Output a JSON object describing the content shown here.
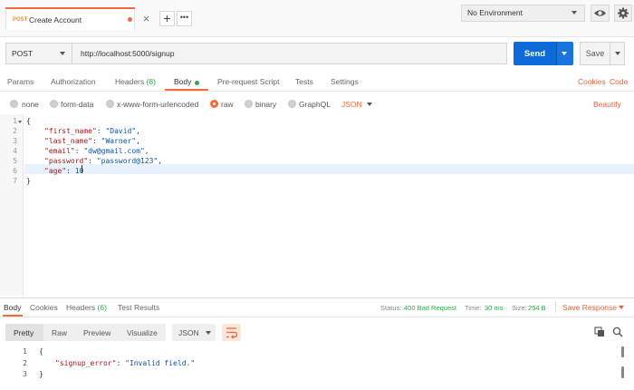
{
  "tab": {
    "method": "POST",
    "title": "Create Account",
    "close_icon": "close-icon",
    "add_label": "+",
    "more_label": "•••"
  },
  "environment": {
    "selected": "No Environment"
  },
  "request": {
    "method": "POST",
    "url": "http://localhost:5000/signup",
    "send_label": "Send",
    "save_label": "Save"
  },
  "request_tabs": [
    {
      "label": "Params"
    },
    {
      "label": "Authorization"
    },
    {
      "label": "Headers",
      "count": "(8)"
    },
    {
      "label": "Body"
    },
    {
      "label": "Pre-request Script"
    },
    {
      "label": "Tests"
    },
    {
      "label": "Settings"
    }
  ],
  "links": {
    "cookies": "Cookies",
    "code": "Code",
    "beautify": "Beautify"
  },
  "body_types": [
    "none",
    "form-data",
    "x-www-form-urlencoded",
    "raw",
    "binary",
    "GraphQL"
  ],
  "body_format": "JSON",
  "editor": {
    "line_numbers": [
      "1",
      "2",
      "3",
      "4",
      "5",
      "6",
      "7"
    ],
    "open_brace": "{",
    "close_brace": "}",
    "fields": [
      {
        "key": "\"first_name\"",
        "value": "\"David\"",
        "tail": ","
      },
      {
        "key": "\"last_name\"",
        "value": "\"Warner\"",
        "tail": ","
      },
      {
        "key": "\"email\"",
        "value": "\"dw@gmail.com\"",
        "tail": ","
      },
      {
        "key": "\"password\"",
        "value": "\"password@123\"",
        "tail": ","
      },
      {
        "key": "\"age\"",
        "value": "10",
        "tail": ""
      }
    ]
  },
  "response_tabs": [
    {
      "label": "Body"
    },
    {
      "label": "Cookies"
    },
    {
      "label": "Headers",
      "count": "(6)"
    },
    {
      "label": "Test Results"
    }
  ],
  "response_meta": {
    "status_label": "Status:",
    "status_value": "400 Bad Request",
    "time_label": "Time:",
    "time_value": "30 ms",
    "size_label": "Size:",
    "size_value": "254 B",
    "save_response": "Save Response"
  },
  "view_modes": [
    "Pretty",
    "Raw",
    "Preview",
    "Visualize"
  ],
  "response_format": "JSON",
  "response_body": {
    "line_numbers": [
      "1",
      "2",
      "3"
    ],
    "open_brace": "{",
    "key": "\"signup_error\"",
    "value": "\"Invalid field.\"",
    "close_brace": "}"
  },
  "colors": {
    "accent": "#f26b3a",
    "send": "#0d6ad9",
    "status_ok": "#2ea84a"
  }
}
